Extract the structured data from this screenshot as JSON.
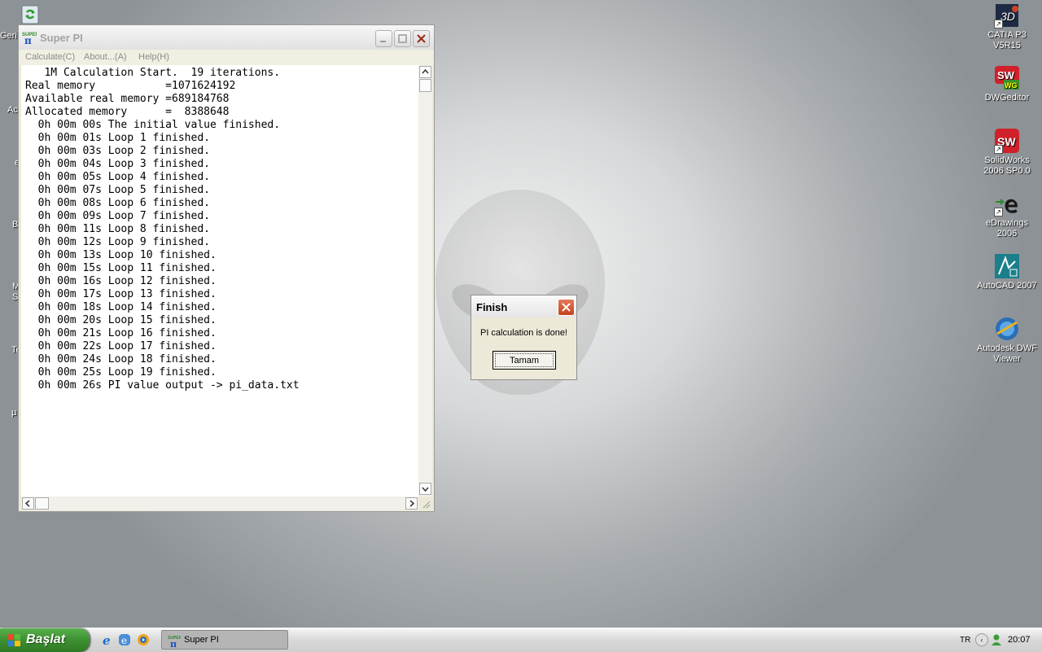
{
  "desktop": {
    "left_icons_clipped": [
      {
        "text": "Geri",
        "icon": "recycle-bin-icon"
      },
      {
        "text": "Ac",
        "icon": "app-icon"
      },
      {
        "text": "e",
        "icon": "app-icon"
      },
      {
        "text": "B",
        "icon": "app-icon"
      },
      {
        "text": "M",
        "icon": "app-icon"
      },
      {
        "text": "S",
        "icon": "app-icon"
      },
      {
        "text": "Te",
        "icon": "app-icon"
      },
      {
        "text": "µ",
        "icon": "app-icon"
      }
    ],
    "right_icons": [
      {
        "label": "CATIA P3 V5R15",
        "icon": "catia-icon"
      },
      {
        "label": "DWGeditor",
        "icon": "dwgeditor-icon"
      },
      {
        "label": "SolidWorks 2006 SP0.0",
        "icon": "solidworks-icon"
      },
      {
        "label": "eDrawings 2006",
        "icon": "edrawings-icon"
      },
      {
        "label": "AutoCAD 2007",
        "icon": "autocad-icon"
      },
      {
        "label": "Autodesk DWF Viewer",
        "icon": "dwf-viewer-icon"
      }
    ]
  },
  "window": {
    "title": "Super PI",
    "app_icon": "superpi-icon",
    "menu": [
      "Calculate(C)",
      "About...(A)",
      "Help(H)"
    ],
    "console_lines": [
      "   1M Calculation Start.  19 iterations.",
      "Real memory           =1071624192",
      "Available real memory =689184768",
      "Allocated memory      =  8388648",
      "  0h 00m 00s The initial value finished.",
      "  0h 00m 01s Loop 1 finished.",
      "  0h 00m 03s Loop 2 finished.",
      "  0h 00m 04s Loop 3 finished.",
      "  0h 00m 05s Loop 4 finished.",
      "  0h 00m 07s Loop 5 finished.",
      "  0h 00m 08s Loop 6 finished.",
      "  0h 00m 09s Loop 7 finished.",
      "  0h 00m 11s Loop 8 finished.",
      "  0h 00m 12s Loop 9 finished.",
      "  0h 00m 13s Loop 10 finished.",
      "  0h 00m 15s Loop 11 finished.",
      "  0h 00m 16s Loop 12 finished.",
      "  0h 00m 17s Loop 13 finished.",
      "  0h 00m 18s Loop 14 finished.",
      "  0h 00m 20s Loop 15 finished.",
      "  0h 00m 21s Loop 16 finished.",
      "  0h 00m 22s Loop 17 finished.",
      "  0h 00m 24s Loop 18 finished.",
      "  0h 00m 25s Loop 19 finished.",
      "  0h 00m 26s PI value output -> pi_data.txt"
    ]
  },
  "dialog": {
    "title": "Finish",
    "message": "PI calculation is done!",
    "ok_label": "Tamam"
  },
  "taskbar": {
    "start_label": "Başlat",
    "quick_launch": [
      "ie-icon",
      "ie-alt-icon",
      "media-player-icon"
    ],
    "task_label": "Super PI",
    "language": "TR",
    "clock": "20:07"
  },
  "colors": {
    "start_green": "#3d8f32",
    "close_red": "#c4411c"
  }
}
